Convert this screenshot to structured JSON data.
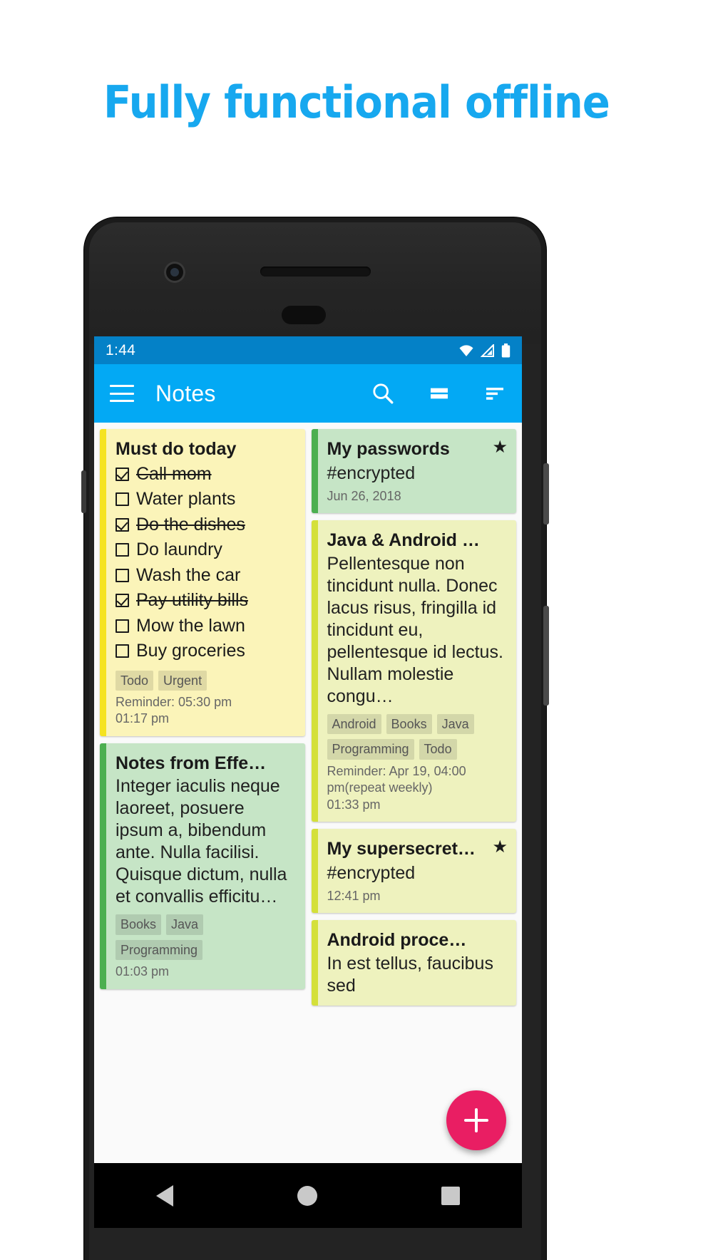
{
  "headline": "Fully functional offline",
  "colors": {
    "headline": "#17a8ef",
    "statusbar": "#0481c7",
    "appbar": "#03a9f4",
    "fab": "#e91e63",
    "yellow_note": "#fbf4b9",
    "yellow_stripe": "#f5e321",
    "green_note": "#c6e5c6",
    "green_stripe": "#4caf50",
    "lime_note": "#eef2be",
    "lime_stripe": "#d4e03a"
  },
  "statusbar": {
    "time": "1:44",
    "icons": [
      "wifi-icon",
      "signal-icon",
      "battery-icon"
    ]
  },
  "appbar": {
    "menu_icon": "hamburger-menu-icon",
    "title": "Notes",
    "actions": [
      "search-icon",
      "layout-toggle-icon",
      "sort-icon"
    ]
  },
  "fab": {
    "label": "+",
    "name": "add-note-fab"
  },
  "navbar": {
    "items": [
      "back-button",
      "home-button",
      "recents-button"
    ]
  },
  "notes": {
    "left": [
      {
        "id": "must-do-today",
        "title": "Must do today",
        "type": "checklist",
        "color": "yellow",
        "items": [
          {
            "text": "Call mom",
            "checked": true
          },
          {
            "text": "Water plants",
            "checked": false
          },
          {
            "text": "Do the dishes",
            "checked": true
          },
          {
            "text": "Do laundry",
            "checked": false
          },
          {
            "text": "Wash the car",
            "checked": false
          },
          {
            "text": "Pay utility bills",
            "checked": true
          },
          {
            "text": "Mow the lawn",
            "checked": false
          },
          {
            "text": "Buy groceries",
            "checked": false
          }
        ],
        "tags": [
          "Todo",
          "Urgent"
        ],
        "reminder": "Reminder: 05:30 pm",
        "date": "01:17 pm",
        "starred": false
      },
      {
        "id": "notes-from-effective-java",
        "title": "Notes from Effe…",
        "type": "text",
        "color": "green",
        "body": "Integer iaculis neque laoreet, posuere ipsum a, bibendum ante. Nulla facilisi. Quisque dictum, nulla et convallis efficitu…",
        "tags": [
          "Books",
          "Java",
          "Programming"
        ],
        "reminder": "",
        "date": "01:03 pm",
        "starred": false
      }
    ],
    "right": [
      {
        "id": "my-passwords",
        "title": "My passwords",
        "type": "text",
        "color": "green",
        "body": "#encrypted",
        "tags": [],
        "reminder": "",
        "date": "Jun 26, 2018",
        "starred": true
      },
      {
        "id": "java-and-android",
        "title": "Java & Android …",
        "type": "text",
        "color": "lime",
        "body": "Pellentesque non tincidunt nulla. Donec lacus risus, fringilla id tincidunt eu, pellentesque id lectus. Nullam molestie congu…",
        "tags": [
          "Android",
          "Books",
          "Java",
          "Programming",
          "Todo"
        ],
        "reminder": "Reminder: Apr 19, 04:00 pm(repeat weekly)",
        "date": "01:33 pm",
        "starred": false
      },
      {
        "id": "my-supersecret",
        "title": "My supersecret…",
        "type": "text",
        "color": "lime",
        "body": "#encrypted",
        "tags": [],
        "reminder": "",
        "date": "12:41 pm",
        "starred": true
      },
      {
        "id": "android-process",
        "title": "Android proce…",
        "type": "text",
        "color": "lime",
        "body": "In est tellus, faucibus sed",
        "tags": [],
        "reminder": "",
        "date": "",
        "starred": false
      }
    ]
  }
}
